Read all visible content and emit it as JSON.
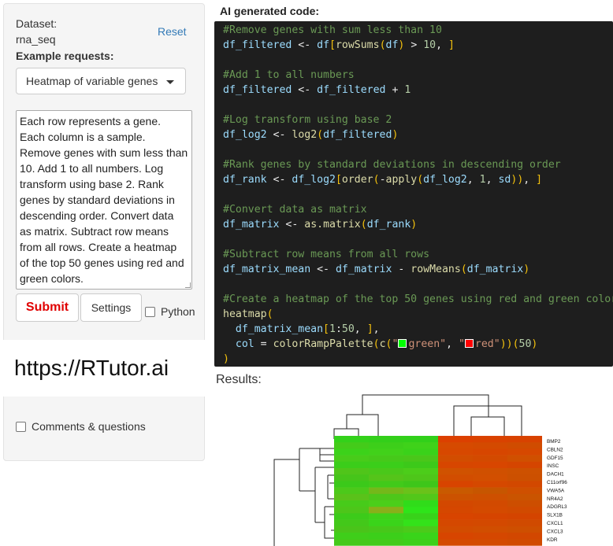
{
  "sidebar": {
    "dataset_label": "Dataset:",
    "dataset_value": "rna_seq",
    "reset_label": "Reset",
    "examples_label": "Example requests:",
    "example_selected": "Heatmap of variable genes",
    "request_text": " Each row represents a gene. Each column is a sample. Remove genes with sum less than 10. Add 1 to all numbers. Log transform using base 2. Rank genes by standard deviations in descending order. Convert data as matrix. Subtract row means from all rows. Create a heatmap of the top 50 genes using red and green colors.",
    "submit_label": "Submit",
    "settings_label": "Settings",
    "python_label": "Python",
    "python_checked": false,
    "brand_url": "https://RTutor.ai",
    "comments_label": "Comments & questions",
    "comments_checked": false
  },
  "code_panel": {
    "title": "AI generated code:",
    "results_label": "Results:"
  },
  "heatmap": {
    "genes": [
      "BMP2",
      "CBLN2",
      "GDF15",
      "INSC",
      "DACH1",
      "C11orf96",
      "VWA5A",
      "NR4A2",
      "ADGRL3",
      "SLX1B",
      "CXCL1",
      "CXCL3",
      "KDR"
    ],
    "low_color": "#1ee61e",
    "high_color": "#dd3300",
    "cell_colors": [
      [
        "#33d11a",
        "#33cf1a",
        "#31d01a",
        "#dc4000",
        "#d94200",
        "#d84200"
      ],
      [
        "#44cb1a",
        "#3dcf1a",
        "#3fd21a",
        "#d64a00",
        "#d44a00",
        "#d04c00"
      ],
      [
        "#3cd21a",
        "#41d11a",
        "#3ad21a",
        "#d74800",
        "#d74600",
        "#d64800"
      ],
      [
        "#48cc1a",
        "#46c91a",
        "#4ac71a",
        "#d24d00",
        "#d34a00",
        "#d05000"
      ],
      [
        "#3bcd1a",
        "#3bce1a",
        "#3cc91a",
        "#d74600",
        "#d84600",
        "#d54500"
      ],
      [
        "#50c51a",
        "#4ac81a",
        "#4ccd1a",
        "#d05200",
        "#d05000",
        "#cd5100"
      ],
      [
        "#46c51a",
        "#55c41a",
        "#4ec61a",
        "#d24d00",
        "#d24f00",
        "#cc5000"
      ],
      [
        "#3bc91a",
        "#41ca1a",
        "#3ec61a",
        "#d84400",
        "#d54800",
        "#d24800"
      ],
      [
        "#4cc91a",
        "#74b81a",
        "#6ac21a",
        "#c95a00",
        "#c75600",
        "#cf5000"
      ],
      [
        "#5ac21a",
        "#4dc71a",
        "#52c71a",
        "#cc5200",
        "#ce5000",
        "#ca5400"
      ],
      [
        "#47cb1a",
        "#4bcf1a",
        "#30dc1a",
        "#d34800",
        "#d24a00",
        "#cd4e00"
      ],
      [
        "#4dc61a",
        "#8ab01a",
        "#2ee41a",
        "#d54700",
        "#d44a00",
        "#d14a00"
      ],
      [
        "#3ccb1a",
        "#40d11a",
        "#38d21a",
        "#d84400",
        "#d64400",
        "#d44400"
      ],
      [
        "#43c81a",
        "#3ad41a",
        "#33e21a",
        "#d44800",
        "#d34900",
        "#d04a00"
      ],
      [
        "#4ac41a",
        "#47c81a",
        "#4bcb1a",
        "#d24c00",
        "#d14e00",
        "#ce4f00"
      ],
      [
        "#3fce1a",
        "#3ccf1a",
        "#39d41a",
        "#d74500",
        "#d54700",
        "#d24700"
      ],
      [
        "#45c91a",
        "#43cb1a",
        "#3dd01a",
        "#d44a00",
        "#d34b00",
        "#d04b00"
      ]
    ]
  }
}
